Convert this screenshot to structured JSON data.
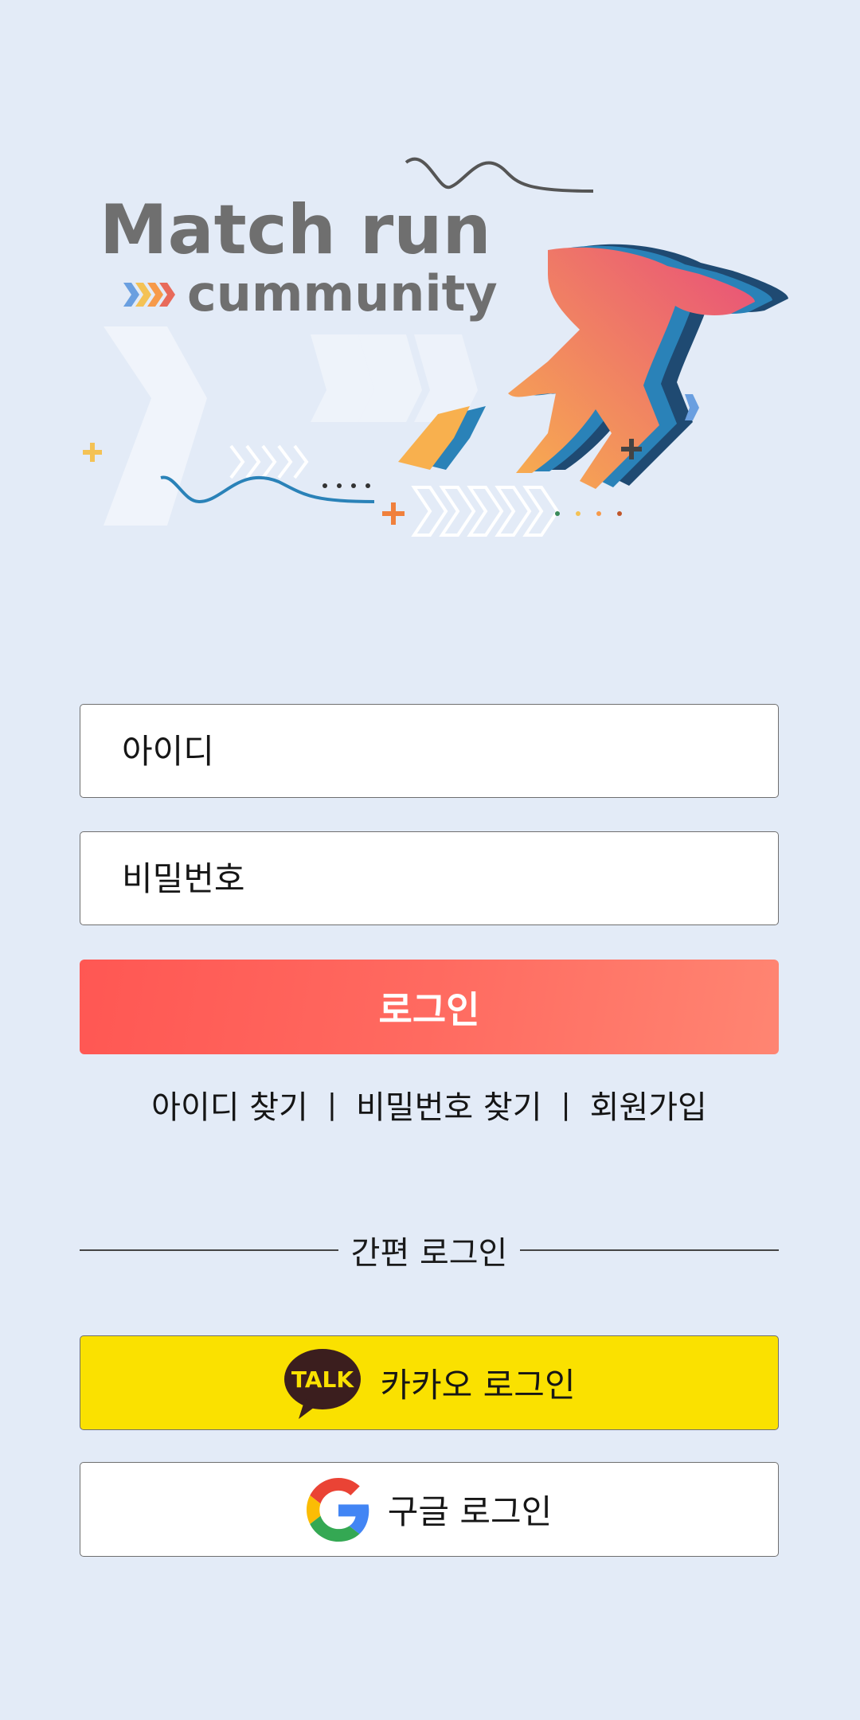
{
  "logo": {
    "title_line1": "Match run",
    "title_line2": "cummunity"
  },
  "login_form": {
    "id_placeholder": "아이디",
    "password_placeholder": "비밀번호",
    "login_button": "로그인"
  },
  "account_links": {
    "find_id": "아이디 찾기",
    "find_password": "비밀번호 찾기",
    "signup": "회원가입",
    "separator": "|"
  },
  "easy_login": {
    "divider_label": "간편 로그인",
    "kakao_label": "카카오 로그인",
    "kakao_icon_text": "TALK",
    "google_label": "구글 로그인"
  },
  "colors": {
    "background": "#e3ebf7",
    "login_button": "#ff5f58",
    "kakao": "#fae100"
  }
}
